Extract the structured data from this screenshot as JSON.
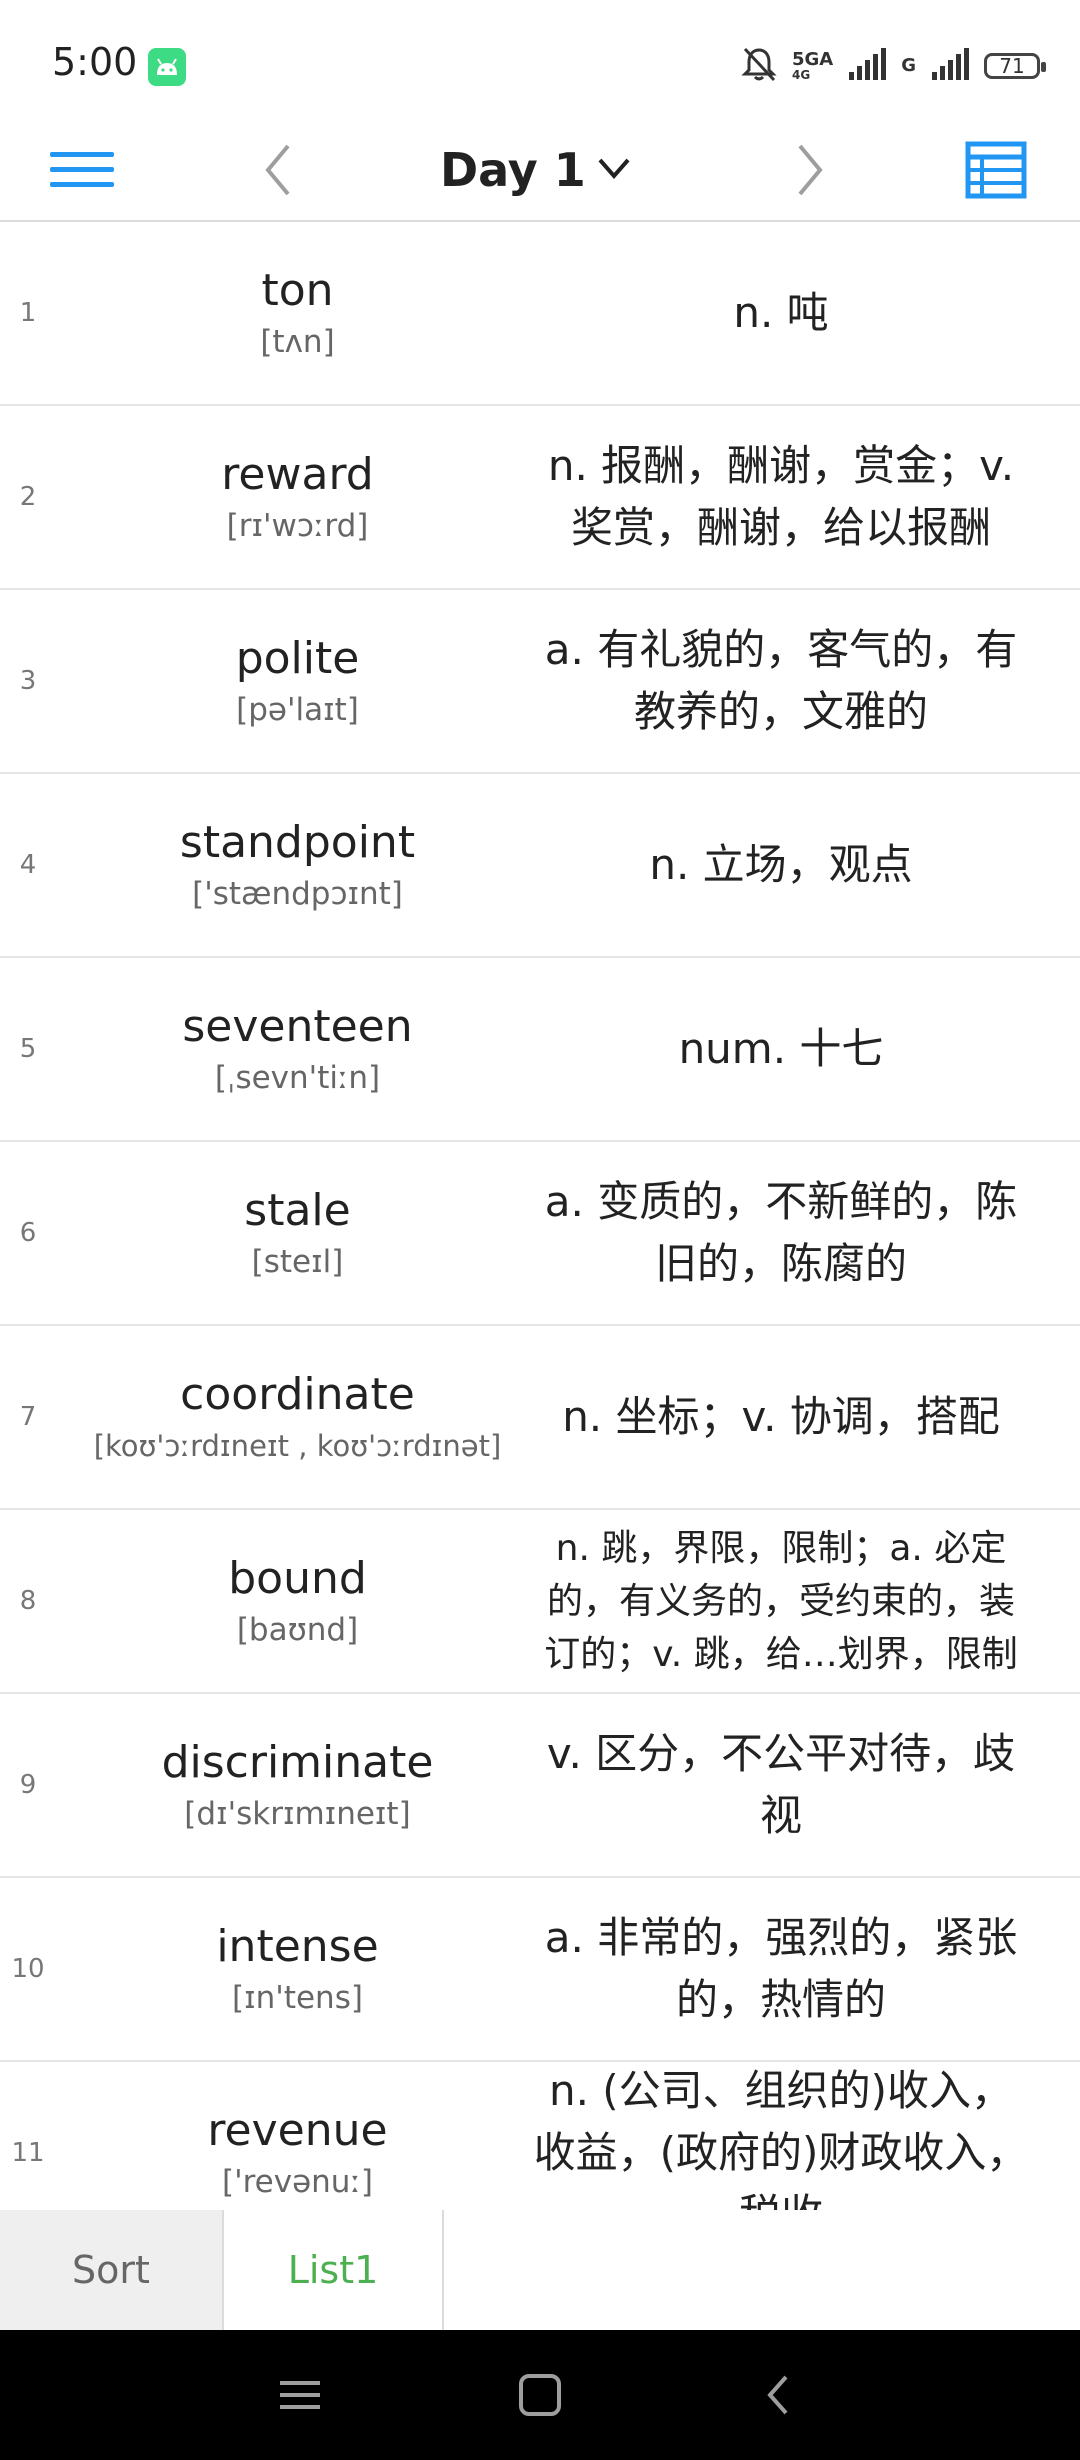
{
  "status_bar": {
    "time": "5:00",
    "network_1": "5GA",
    "network_1_sub": "4G",
    "network_2": "G",
    "battery": "71",
    "icons": [
      "android-icon",
      "mute-bell-icon",
      "signal-icon",
      "battery-icon"
    ]
  },
  "toolbar": {
    "title": "Day 1",
    "icons": [
      "hamburger-menu-icon",
      "chevron-left-icon",
      "chevron-down-icon",
      "chevron-right-icon",
      "list-view-icon"
    ],
    "accent_color": "#2196f3"
  },
  "words": [
    {
      "index": "1",
      "word": "ton",
      "phonetic": "[tʌn]",
      "definition": "n. 吨"
    },
    {
      "index": "2",
      "word": "reward",
      "phonetic": "[rɪ'wɔːrd]",
      "definition": "n. 报酬，酬谢，赏金；v. 奖赏，酬谢，给以报酬"
    },
    {
      "index": "3",
      "word": "polite",
      "phonetic": "[pə'laɪt]",
      "definition": "a. 有礼貌的，客气的，有教养的，文雅的"
    },
    {
      "index": "4",
      "word": "standpoint",
      "phonetic": "['stændpɔɪnt]",
      "definition": "n. 立场，观点"
    },
    {
      "index": "5",
      "word": "seventeen",
      "phonetic": "[ˌsevn'tiːn]",
      "definition": "num. 十七"
    },
    {
      "index": "6",
      "word": "stale",
      "phonetic": "[steɪl]",
      "definition": "a. 变质的，不新鲜的，陈旧的，陈腐的"
    },
    {
      "index": "7",
      "word": "coordinate",
      "phonetic": "[koʊ'ɔːrdɪneɪt , koʊ'ɔːrdɪnət]",
      "definition": "n. 坐标；v. 协调，搭配"
    },
    {
      "index": "8",
      "word": "bound",
      "phonetic": "[baʊnd]",
      "definition": "n. 跳，界限，限制；a. 必定的，有义务的，受约束的，装订的；v. 跳，给…划界，限制"
    },
    {
      "index": "9",
      "word": "discriminate",
      "phonetic": "[dɪ'skrɪmɪneɪt]",
      "definition": "v. 区分，不公平对待，歧视"
    },
    {
      "index": "10",
      "word": "intense",
      "phonetic": "[ɪn'tens]",
      "definition": "a. 非常的，强烈的，紧张的，热情的"
    },
    {
      "index": "11",
      "word": "revenue",
      "phonetic": "['revənuː]",
      "definition": "n. (公司、组织的)收入，收益，(政府的)财政收入，税收"
    }
  ],
  "tabs": {
    "sort": "Sort",
    "list1": "List1",
    "active_color": "#4caf50"
  },
  "nav_bar": {
    "icons": [
      "recents-icon",
      "home-icon",
      "back-icon"
    ]
  }
}
